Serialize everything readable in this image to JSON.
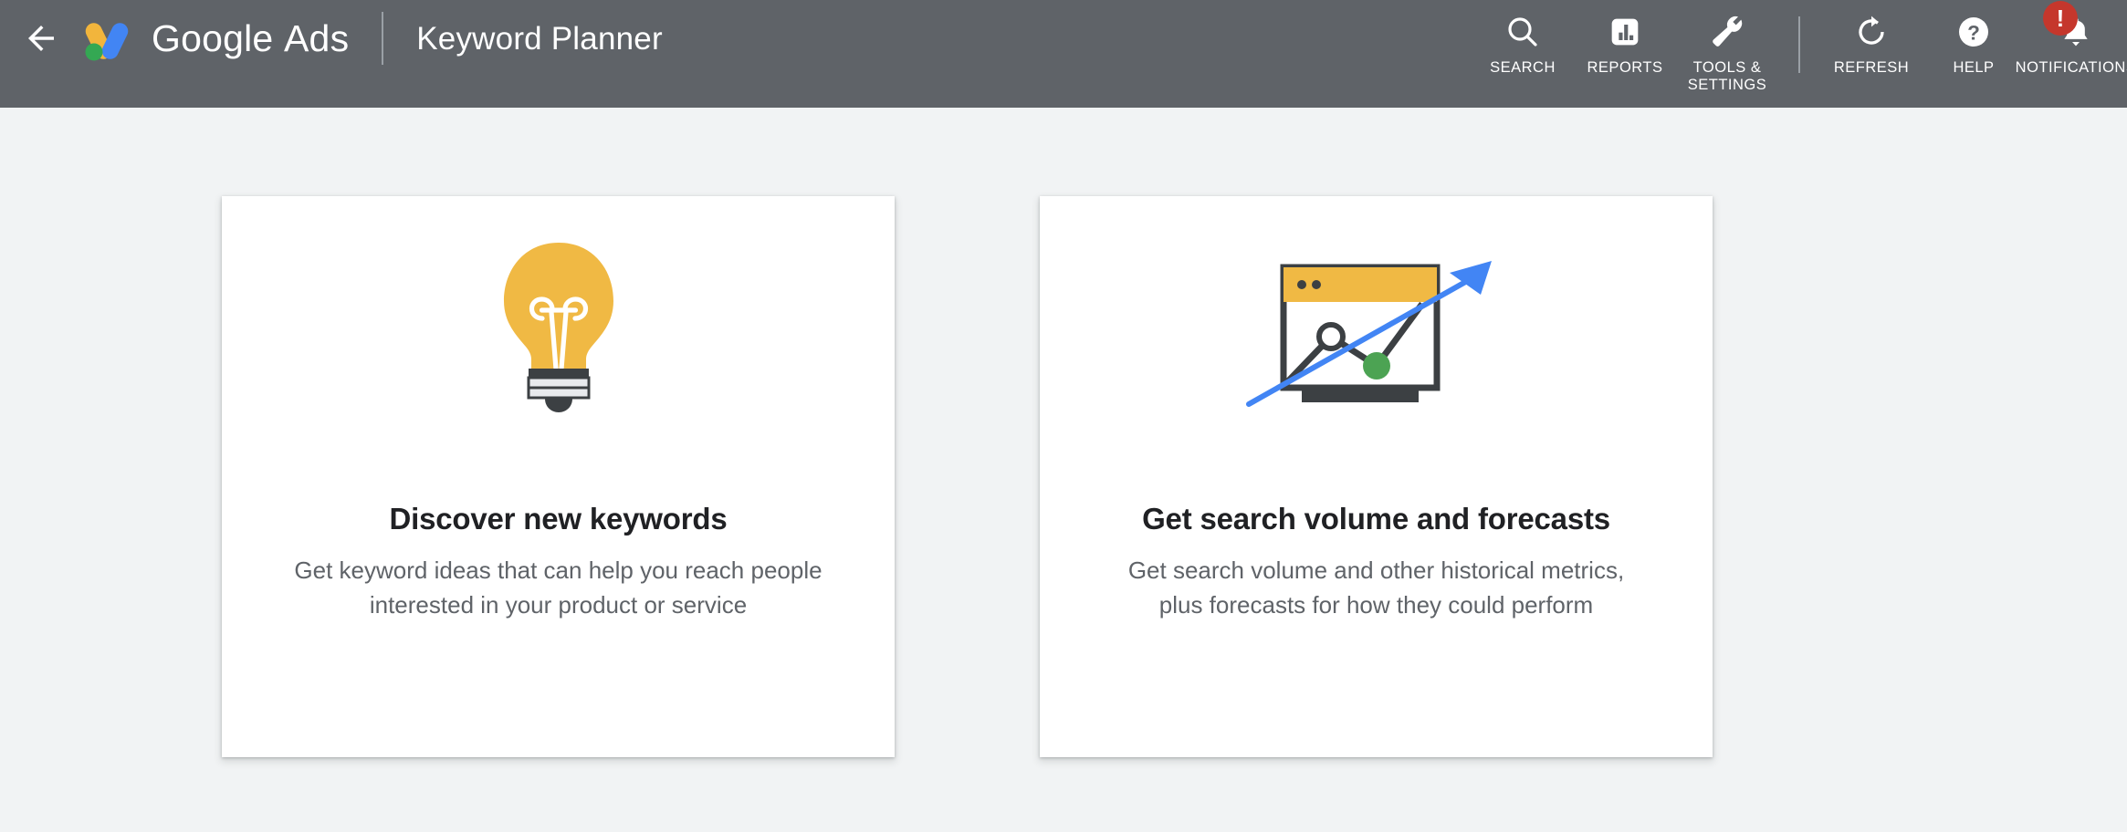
{
  "header": {
    "back_icon": "back-arrow-icon",
    "logo_icon": "google-ads-logo",
    "brand_light": "Google",
    "brand_bold": "Ads",
    "page_title": "Keyword Planner",
    "colors": {
      "bar": "#5f6368",
      "logo_yellow": "#F2B53C",
      "logo_blue": "#4285F4",
      "logo_green": "#34A853"
    },
    "tools": [
      {
        "label": "SEARCH",
        "icon": "search-icon"
      },
      {
        "label": "REPORTS",
        "icon": "reports-icon"
      },
      {
        "label": "TOOLS &\nSETTINGS",
        "icon": "wrench-icon"
      },
      {
        "label": "REFRESH",
        "icon": "refresh-icon"
      },
      {
        "label": "HELP",
        "icon": "help-icon"
      },
      {
        "label": "NOTIFICATIONS",
        "icon": "bell-icon",
        "badge": "!"
      }
    ]
  },
  "main": {
    "background_color": "#f1f3f4",
    "cards": [
      {
        "art_icon": "lightbulb-icon",
        "title": "Discover new keywords",
        "description": "Get keyword ideas that can help you reach people\ninterested in your product or service"
      },
      {
        "art_icon": "browser-chart-arrow-icon",
        "title": "Get search volume and forecasts",
        "description": "Get search volume and other historical metrics,\nplus forecasts for how they could perform"
      }
    ]
  }
}
